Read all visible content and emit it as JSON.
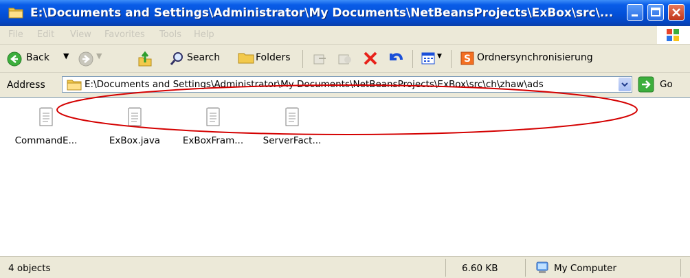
{
  "window": {
    "title": "E:\\Documents and Settings\\Administrator\\My Documents\\NetBeansProjects\\ExBox\\src\\...",
    "minimize_icon": "minimize-icon",
    "maximize_icon": "maximize-icon",
    "close_icon": "close-icon"
  },
  "menu": [
    "File",
    "Edit",
    "View",
    "Favorites",
    "Tools",
    "Help"
  ],
  "toolbar": {
    "back": "Back",
    "search": "Search",
    "folders": "Folders",
    "sync": "Ordnersynchronisierung"
  },
  "address": {
    "label": "Address",
    "value": "E:\\Documents and Settings\\Administrator\\My Documents\\NetBeansProjects\\ExBox\\src\\ch\\zhaw\\ads",
    "go": "Go"
  },
  "files": [
    {
      "name": "CommandE..."
    },
    {
      "name": "ExBox.java"
    },
    {
      "name": "ExBoxFram..."
    },
    {
      "name": "ServerFact..."
    }
  ],
  "status": {
    "objects": "4 objects",
    "size": "6.60 KB",
    "zone": "My Computer"
  },
  "colors": {
    "titlebar": "#0350d8",
    "chrome": "#ece9d8",
    "annotation": "#d40000"
  }
}
